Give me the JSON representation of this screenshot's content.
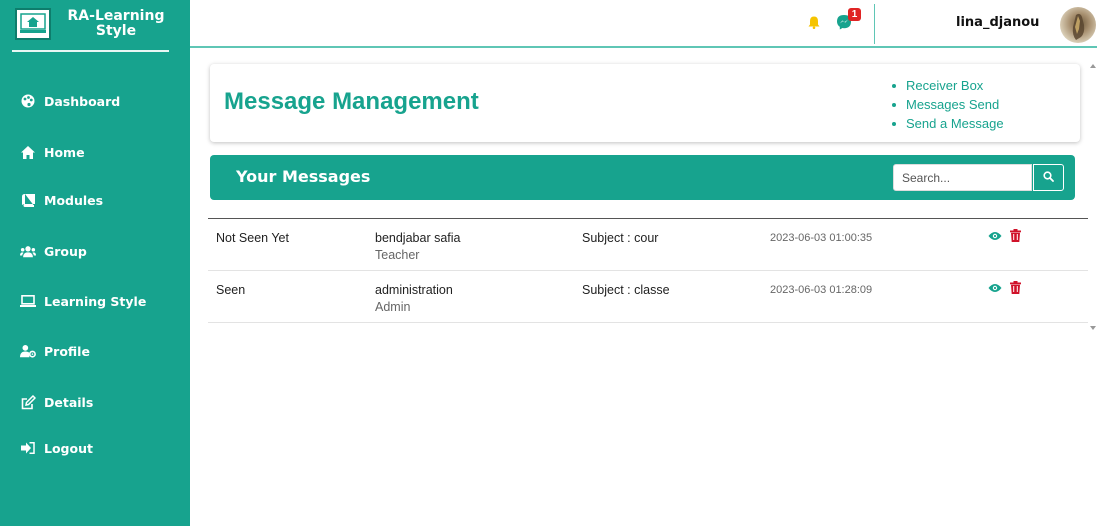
{
  "brand": {
    "name": "RA-Learning Style"
  },
  "sidebar": {
    "items": [
      {
        "label": "Dashboard",
        "icon": "palette-icon"
      },
      {
        "label": "Home",
        "icon": "home-icon"
      },
      {
        "label": "Modules",
        "icon": "book-icon"
      },
      {
        "label": "Group",
        "icon": "users-icon"
      },
      {
        "label": "Learning Style",
        "icon": "laptop-icon"
      },
      {
        "label": "Profile",
        "icon": "user-gear-icon"
      },
      {
        "label": "Details",
        "icon": "edit-icon"
      },
      {
        "label": "Logout",
        "icon": "sign-out-icon"
      }
    ]
  },
  "topbar": {
    "notifications_icon": "bell-icon",
    "messages_icon": "messenger-icon",
    "messages_badge": "1",
    "username": "lina_djanou"
  },
  "header": {
    "title_light": "Message",
    "title_bold": "Management",
    "links": [
      "Receiver Box",
      "Messages Send",
      "Send a Message"
    ]
  },
  "messages": {
    "title": "Your Messages",
    "search_placeholder": "Search...",
    "rows": [
      {
        "status": "Not Seen Yet",
        "sender": "bendjabar safia",
        "role": "Teacher",
        "subject": "Subject : cour",
        "date": "2023-06-03 01:00:35"
      },
      {
        "status": "Seen",
        "sender": "administration",
        "role": "Admin",
        "subject": "Subject : classe",
        "date": "2023-06-03 01:28:09"
      }
    ]
  },
  "colors": {
    "primary": "#17a38e",
    "badge": "#e02424",
    "bell": "#f5c400",
    "delete": "#d0122a",
    "view": "#17a38e"
  }
}
